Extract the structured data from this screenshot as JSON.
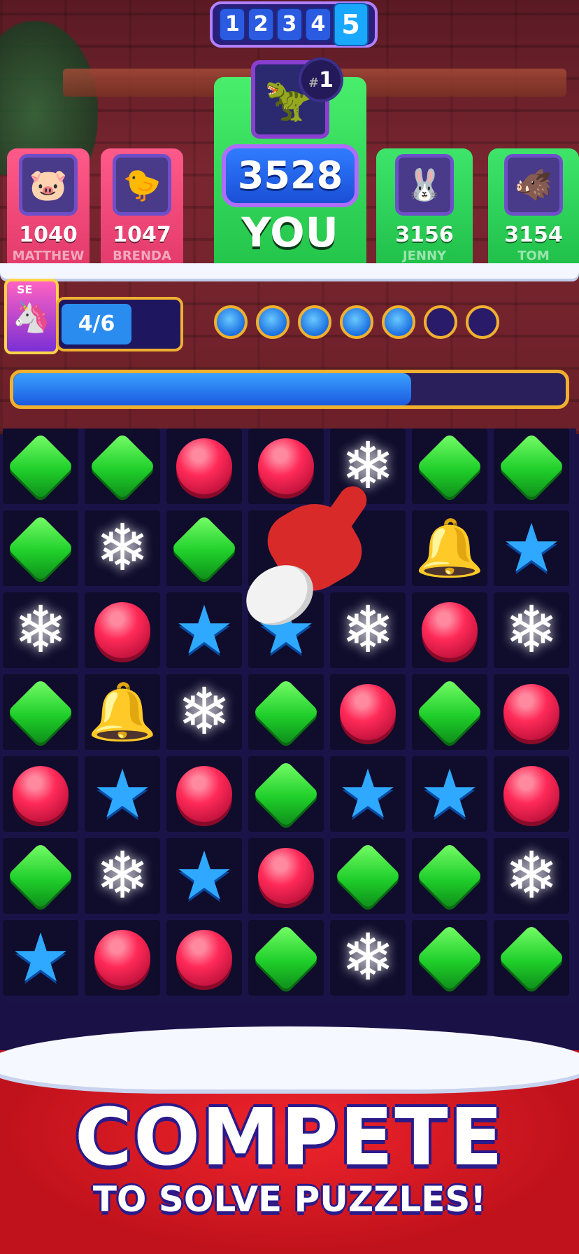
{
  "rounds": {
    "items": [
      "1",
      "2",
      "3",
      "4",
      "5"
    ],
    "current": "5"
  },
  "you": {
    "score": "3528",
    "label": "YOU",
    "rank_hash": "#",
    "rank": "1"
  },
  "players": [
    {
      "score": "1040",
      "name": "MATTHEW"
    },
    {
      "score": "1047",
      "name": "BRENDA"
    },
    {
      "score": "3156",
      "name": "JENNY"
    },
    {
      "score": "3154",
      "name": "TOM"
    }
  ],
  "collect": {
    "badge": "SE",
    "progress": "4/6",
    "filled_dots": 5,
    "total_dots": 7
  },
  "level_bar": {
    "fill_fraction": 0.72
  },
  "board": {
    "rows": [
      [
        "green",
        "green",
        "red",
        "red",
        "flake",
        "green",
        "green"
      ],
      [
        "green",
        "flake",
        "green",
        "empty",
        "empty",
        "bell",
        "star"
      ],
      [
        "flake",
        "red",
        "star",
        "star",
        "flake",
        "red",
        "flake"
      ],
      [
        "green",
        "bell",
        "flake",
        "green",
        "red",
        "green",
        "red"
      ],
      [
        "red",
        "star",
        "red",
        "green",
        "star",
        "star",
        "red"
      ],
      [
        "green",
        "flake",
        "star",
        "red",
        "green",
        "green",
        "flake"
      ],
      [
        "star",
        "red",
        "red",
        "green",
        "flake",
        "green",
        "green"
      ]
    ]
  },
  "banner": {
    "headline": "COMPETE",
    "subline": "TO SOLVE PUZZLES!"
  }
}
